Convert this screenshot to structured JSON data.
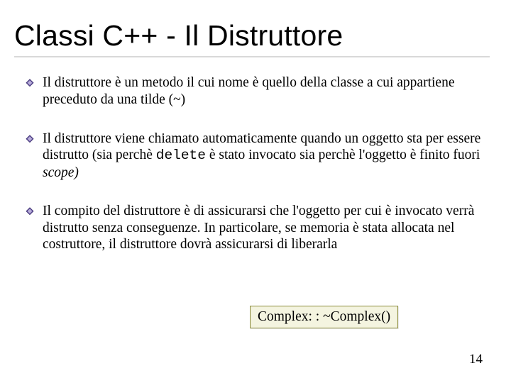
{
  "title": "Classi C++ - Il Distruttore",
  "bullets": [
    {
      "pre": "Il distruttore è un metodo il cui nome è quello della classe a cui appartiene preceduto da una tilde (~)",
      "code": "",
      "mid": "",
      "italic": "",
      "post": ""
    },
    {
      "pre": "Il distruttore viene chiamato automaticamente quando un oggetto sta per essere distrutto (sia perchè ",
      "code": "delete",
      "mid": " è stato invocato sia perchè l'oggetto è finito fuori ",
      "italic": "scope)",
      "post": ""
    },
    {
      "pre": "Il compito del distruttore è  di assicurarsi che l'oggetto per cui è invocato verrà distrutto senza conseguenze. In particolare, se memoria è stata allocata nel costruttore, il distruttore dovrà assicurarsi di liberarla",
      "code": "",
      "mid": "",
      "italic": "",
      "post": ""
    }
  ],
  "code_box": "Complex: : ~Complex()",
  "page_number": "14"
}
